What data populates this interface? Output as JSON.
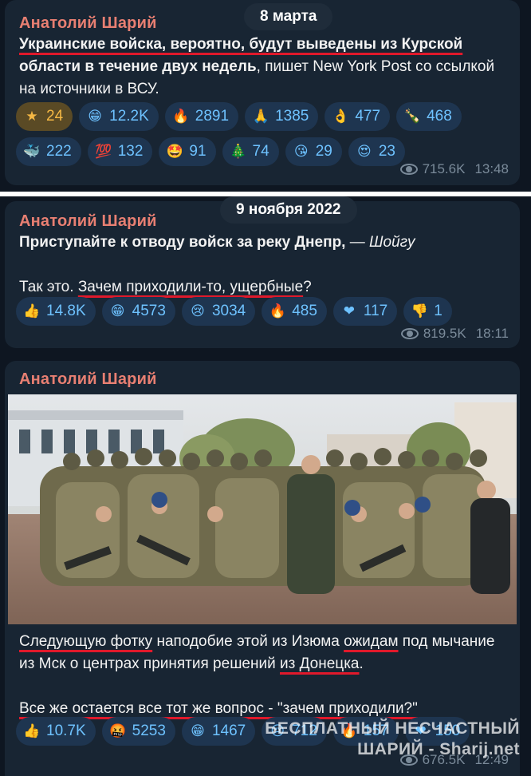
{
  "msg1": {
    "author": "Анатолий Шарий",
    "date": "8 марта",
    "headline_1": "Украинские войска, вероятно, будут выведены из Курской",
    "headline_2": "области в течение двух недель",
    "rest": ", пишет New York Post со ссылкой на источники в ВСУ.",
    "reactions": [
      {
        "icon": "star-icon",
        "glyph": "★",
        "count": "24",
        "active": true
      },
      {
        "icon": "grin-icon",
        "glyph": "😁",
        "count": "12.2K"
      },
      {
        "icon": "fire-icon",
        "glyph": "🔥",
        "count": "2891"
      },
      {
        "icon": "pray-icon",
        "glyph": "🙏",
        "count": "1385"
      },
      {
        "icon": "ok-hand-icon",
        "glyph": "👌",
        "count": "477"
      },
      {
        "icon": "champagne-icon",
        "glyph": "🍾",
        "count": "468"
      },
      {
        "icon": "whale-icon",
        "glyph": "🐳",
        "count": "222"
      },
      {
        "icon": "hundred-icon",
        "glyph": "💯",
        "count": "132"
      },
      {
        "icon": "star-struck-icon",
        "glyph": "🤩",
        "count": "91"
      },
      {
        "icon": "xmas-tree-icon",
        "glyph": "🎄",
        "count": "74"
      },
      {
        "icon": "kiss-icon",
        "glyph": "😘",
        "count": "29"
      },
      {
        "icon": "heart-eyes-icon",
        "glyph": "😍",
        "count": "23"
      }
    ],
    "views": "715.6K",
    "time": "13:48"
  },
  "msg2": {
    "author": "Анатолий Шарий",
    "date": "9 ноября 2022",
    "line1_bold": "Приступайте к отводу войск за реку Днепр,",
    "line1_dash": " — ",
    "line1_italic": "Шойгу",
    "line2_pre": "Так это. ",
    "line2_ul": "Зачем приходили-то, ущербные",
    "line2_post": "?",
    "reactions": [
      {
        "icon": "thumbs-up-icon",
        "glyph": "👍",
        "count": "14.8K"
      },
      {
        "icon": "grin-icon",
        "glyph": "😁",
        "count": "4573"
      },
      {
        "icon": "cry-icon",
        "glyph": "😢",
        "count": "3034"
      },
      {
        "icon": "fire-icon",
        "glyph": "🔥",
        "count": "485"
      },
      {
        "icon": "heart-icon",
        "glyph": "❤",
        "count": "117"
      },
      {
        "icon": "thumbs-down-icon",
        "glyph": "👎",
        "count": "1"
      }
    ],
    "views": "819.5K",
    "time": "18:11"
  },
  "msg3": {
    "author": "Анатолий Шарий",
    "p1_ul1": "Следующую фотку",
    "p1_a": " наподобие этой из Изюма ",
    "p1_ul2": "ожидам",
    "p1_b": " под мычание из Мск о центрах принятия решений ",
    "p1_ul3": "из Донецка",
    "p1_c": ".",
    "p2": "Все же остается все тот же вопрос - \"зачем приходили?\"",
    "reactions": [
      {
        "icon": "thumbs-up-icon",
        "glyph": "👍",
        "count": "10.7K"
      },
      {
        "icon": "cursing-face-icon",
        "glyph": "🤬",
        "count": "5253"
      },
      {
        "icon": "grin-icon",
        "glyph": "😁",
        "count": "1467"
      },
      {
        "icon": "cry-icon",
        "glyph": "😢",
        "count": "712"
      },
      {
        "icon": "fire-icon",
        "glyph": "🔥",
        "count": "157"
      },
      {
        "icon": "heart-icon",
        "glyph": "❤",
        "count": "150"
      }
    ],
    "views": "676.5K",
    "time": "12:49"
  },
  "watermark": {
    "line1": "БЕСПЛАТНЫЙ НЕСЧАСТНЫЙ",
    "line2": "ШАРИЙ - Sharij.net"
  },
  "colors": {
    "background": "#0e1621",
    "bubble": "#182533",
    "author": "#e87f72",
    "reaction_chip": "#1e3550",
    "reaction_text": "#6ec2ff",
    "underline": "#e0192b"
  }
}
